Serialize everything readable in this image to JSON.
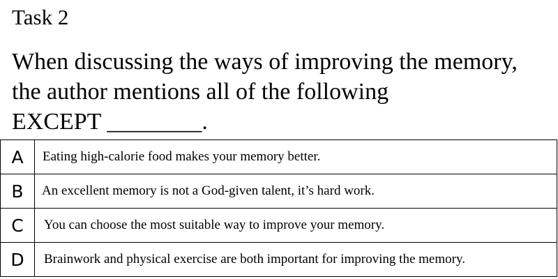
{
  "task": {
    "title": "Task 2"
  },
  "question": {
    "line1": "When discussing the ways of improving the memory,",
    "line2": "the author mentions all of the following",
    "line3": "EXCEPT ________."
  },
  "options": [
    {
      "letter": "A",
      "text": "Eating high-calorie food makes your memory better."
    },
    {
      "letter": "B",
      "text": "An excellent memory is not a God-given talent, it’s hard work."
    },
    {
      "letter": "C",
      "text": "You can choose the most suitable way to improve your memory."
    },
    {
      "letter": "D",
      "text": "Brainwork and physical exercise are both important for improving the memory."
    }
  ]
}
